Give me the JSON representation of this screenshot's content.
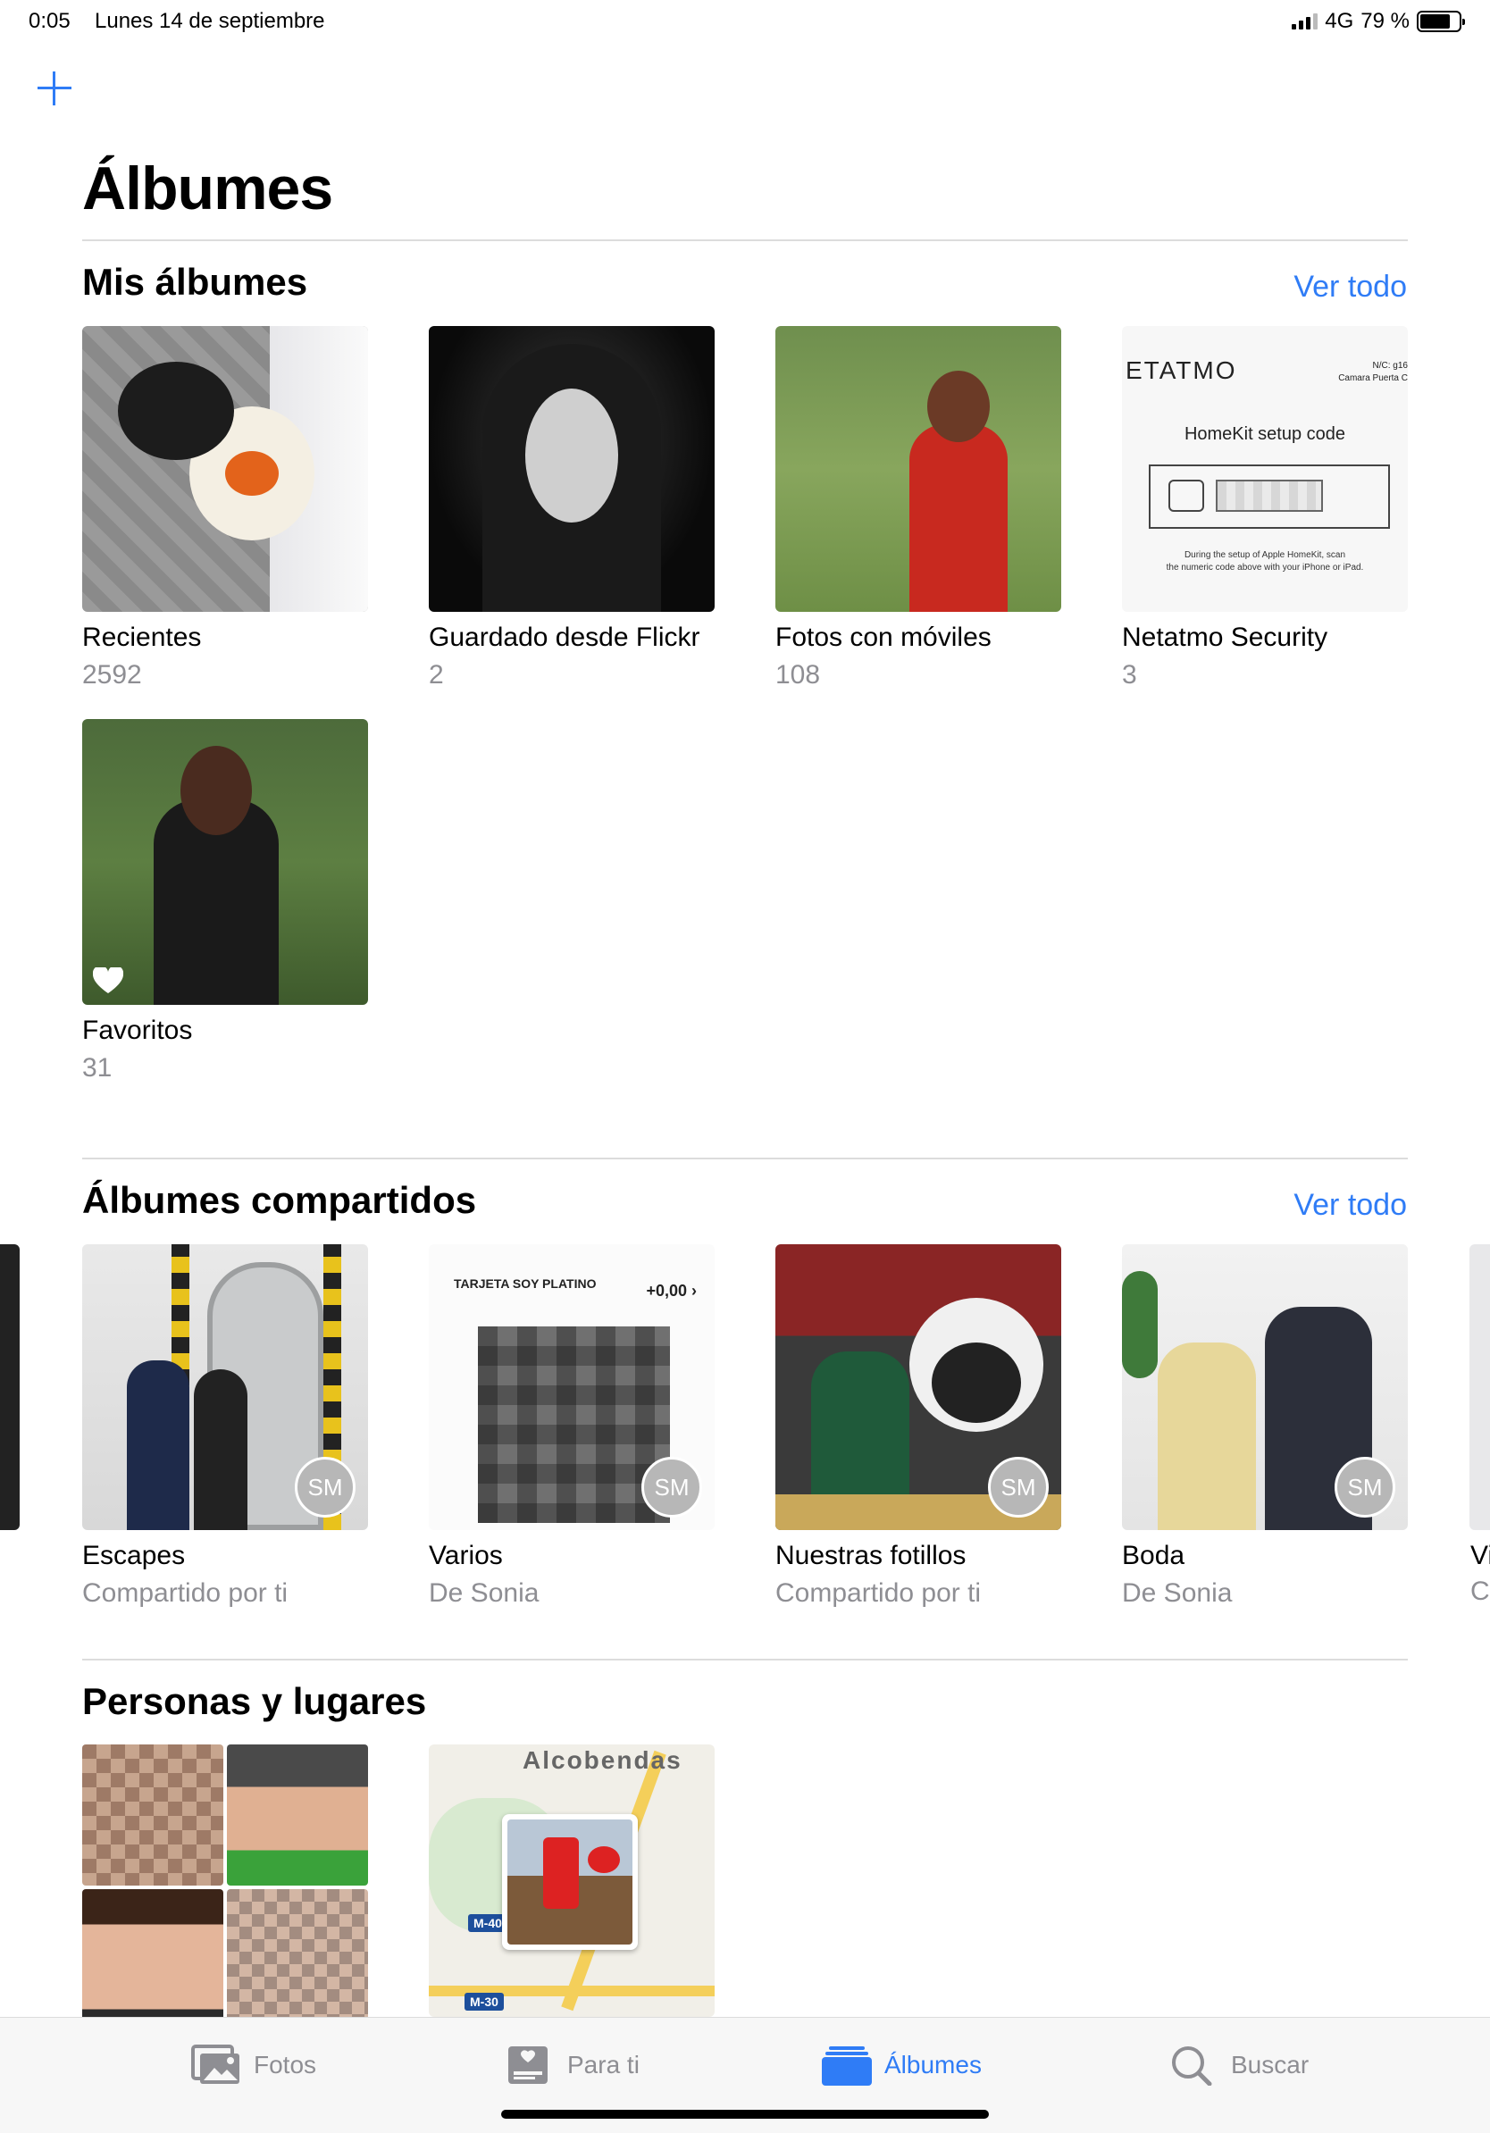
{
  "status_bar": {
    "time": "0:05",
    "date": "Lunes 14 de septiembre",
    "network": "4G",
    "battery": "79 %",
    "battery_level": 0.79
  },
  "page_title": "Álbumes",
  "my_albums": {
    "title": "Mis álbumes",
    "see_all": "Ver todo",
    "items": [
      {
        "name": "Recientes",
        "count": "2592"
      },
      {
        "name": "Guardado desde Flickr",
        "count": "2"
      },
      {
        "name": "Fotos con móviles",
        "count": "108"
      },
      {
        "name": "Netatmo Security",
        "count": "3"
      },
      {
        "name": "Favoritos",
        "count": "31"
      }
    ],
    "netatmo_thumb": {
      "brand": "ETATMO",
      "nc_line1": "N/C: g16",
      "nc_line2": "Camara Puerta C",
      "homekit": "HomeKit setup code",
      "note_line1": "During the setup of Apple HomeKit, scan",
      "note_line2": "the numeric code above with your iPhone or iPad."
    }
  },
  "shared_albums": {
    "title": "Álbumes compartidos",
    "see_all": "Ver todo",
    "badge": "SM",
    "items": [
      {
        "name": "Escapes",
        "owner": "Compartido por ti"
      },
      {
        "name": "Varios",
        "owner": "De Sonia"
      },
      {
        "name": "Nuestras fotillos",
        "owner": "Compartido por ti"
      },
      {
        "name": "Boda",
        "owner": "De Sonia"
      }
    ],
    "partial_next": {
      "name": "Vi",
      "owner": "C"
    },
    "varios_thumb": {
      "card": "TARJETA SOY PLATINO",
      "amount": "+0,00 ›"
    }
  },
  "people_places": {
    "title": "Personas y lugares",
    "map_label": "Alcobendas",
    "road1": "M-40",
    "road2": "M-30"
  },
  "tabbar": {
    "tabs": [
      {
        "label": "Fotos",
        "icon": "photos-icon"
      },
      {
        "label": "Para ti",
        "icon": "for-you-icon"
      },
      {
        "label": "Álbumes",
        "icon": "albums-icon"
      },
      {
        "label": "Buscar",
        "icon": "search-icon"
      }
    ],
    "active_tab": "Álbumes",
    "accent_color": "#2f7cf6"
  }
}
